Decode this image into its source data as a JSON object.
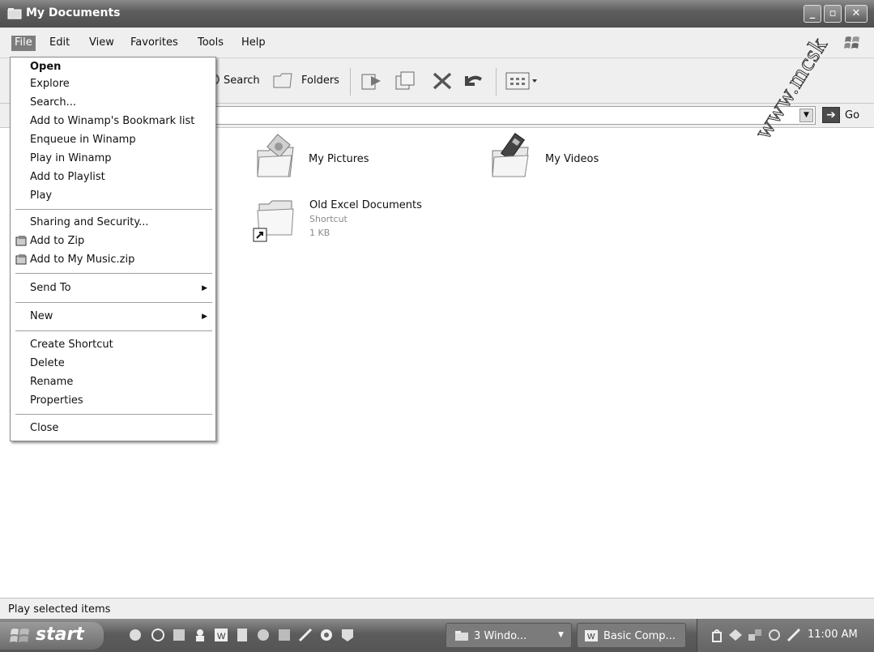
{
  "window": {
    "title": "My Documents"
  },
  "menubar": {
    "items": [
      "File",
      "Edit",
      "View",
      "Favorites",
      "Tools",
      "Help"
    ],
    "active": "File"
  },
  "toolbar": {
    "search_label": "Search",
    "folders_label": "Folders"
  },
  "addressbar": {
    "go_label": "Go"
  },
  "file_menu": {
    "items": [
      {
        "label": "Open",
        "bold": true
      },
      {
        "label": "Explore"
      },
      {
        "label": "Search..."
      },
      {
        "label": "Add to Winamp's Bookmark list"
      },
      {
        "label": "Enqueue in Winamp"
      },
      {
        "label": "Play in Winamp"
      },
      {
        "label": "Add to Playlist"
      },
      {
        "label": "Play"
      },
      {
        "label": "Sharing and Security..."
      },
      {
        "label": "Add to Zip"
      },
      {
        "label": "Add to My Music.zip"
      },
      {
        "label": "Send To"
      },
      {
        "label": "New"
      },
      {
        "label": "Create Shortcut"
      },
      {
        "label": "Delete"
      },
      {
        "label": "Rename"
      },
      {
        "label": "Properties"
      },
      {
        "label": "Close"
      }
    ]
  },
  "content": {
    "items": [
      {
        "label": "My Pictures",
        "icon": "pictures-folder-icon"
      },
      {
        "label": "My Videos",
        "icon": "videos-folder-icon"
      },
      {
        "label": "Old Excel Documents",
        "type": "Shortcut",
        "size": "1 KB",
        "icon": "shortcut-folder-icon"
      }
    ]
  },
  "statusbar": {
    "text": "Play selected items"
  },
  "taskbar": {
    "start_label": "start",
    "tasks": [
      "3 Windo...",
      "Basic Comp..."
    ],
    "clock": "11:00 AM"
  },
  "watermark": {
    "text": "www.mcsk"
  },
  "colors": {
    "titlebar": "#5e5e5e",
    "menu_active": "#7d7d7d",
    "taskbar": "#5c5c5c"
  }
}
